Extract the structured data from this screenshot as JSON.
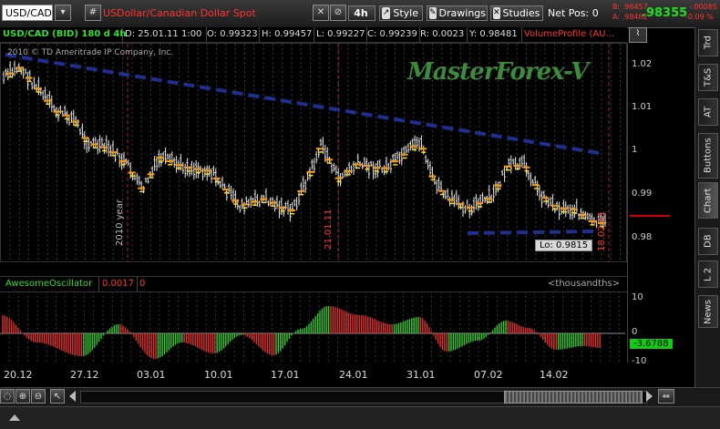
{
  "toolbar": {
    "symbol": "USD/CAD",
    "hash": "#",
    "description": "USDollar/Canadian Dollar Spot",
    "timeframe": "4h",
    "style_label": "Style",
    "drawings_label": "Drawings",
    "studies_label": "Studies",
    "netpos_label": "Net Pos: 0",
    "bid_label": "B:",
    "bid_value": ".98457",
    "ask_label": "A:",
    "ask_value": ".98482",
    "last_price": ".98355",
    "change": "-.00085",
    "change_pct": "-0.09 %"
  },
  "header": {
    "symbol": "USD/CAD (BID) 180 d 4h",
    "date": "D: 25.01.11 1:00",
    "open": "O: 0.99323",
    "high": "H: 0.99457",
    "low": "L: 0.99227",
    "close": "C: 0.99239",
    "range": "R: 0.0023",
    "y": "Y: 0.98481",
    "study": "VolumeProfile (AU..."
  },
  "watermark": "MasterForex-V",
  "copyright": "2010 © TD Ameritrade IP Company, Inc.",
  "annotations": {
    "year_marker": "2010 year",
    "date_marker_1": "21.01.11",
    "date_marker_2": "18.02.11",
    "low_label": "Lo: 0.9815"
  },
  "price_axis": [
    "1.02",
    "1.01",
    "1",
    "0.99",
    "0.98"
  ],
  "oscillator": {
    "name": "AwesomeOscillator",
    "value1": "0.0017",
    "value2": "0",
    "units": "<thousandths>",
    "axis": [
      "10",
      "0",
      "-10"
    ],
    "current_value": "-3.6788"
  },
  "x_axis": [
    "20.12",
    "27.12",
    "03.01",
    "10.01",
    "17.01",
    "24.01",
    "31.01",
    "07.02",
    "14.02"
  ],
  "right_tabs": [
    "Trd",
    "T&S",
    "AT",
    "Buttons",
    "Chart",
    "DB",
    "L 2",
    "News"
  ],
  "colors": {
    "up_bar": "#39c832",
    "down_bar": "#e03030",
    "trendline": "#1f2f8f",
    "accent_red": "#ff3030",
    "accent_green": "#22dd22"
  }
}
